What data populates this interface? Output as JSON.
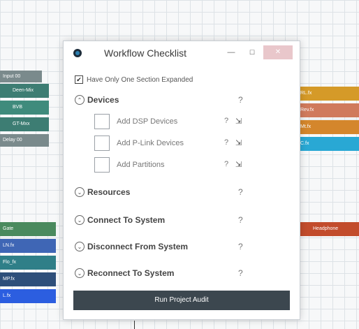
{
  "window": {
    "title": "Workflow Checklist",
    "min_symbol": "—",
    "max_symbol": "☐",
    "close_symbol": "✕"
  },
  "options": {
    "expand_check": "✔",
    "expand_label": "Have Only One Section Expanded"
  },
  "sections": [
    {
      "label": "Devices",
      "chevron": "⌃",
      "help": "?"
    },
    {
      "label": "Resources",
      "chevron": "⌄",
      "help": "?"
    },
    {
      "label": "Connect To System",
      "chevron": "⌄",
      "help": "?"
    },
    {
      "label": "Disconnect From System",
      "chevron": "⌄",
      "help": "?"
    },
    {
      "label": "Reconnect To System",
      "chevron": "⌄",
      "help": "?"
    }
  ],
  "device_items": [
    {
      "label": "Add DSP Devices",
      "help": "?",
      "pin": "⇲"
    },
    {
      "label": "Add P-Link Devices",
      "help": "?",
      "pin": "⇲"
    },
    {
      "label": "Add Partitions",
      "help": "?",
      "pin": "⇲"
    }
  ],
  "audit_button": "Run Project Audit",
  "background_blocks": {
    "left_top": [
      "Input 00",
      "Deen-Mix",
      "BVB",
      "GT-Mxx",
      "Delay 00"
    ],
    "left_bottom": [
      "Gate",
      "LN.fx",
      "Flo_fx",
      "MP.fx",
      "L.fx"
    ],
    "right_top": [
      "RL.fx",
      "Rev.fx",
      "Mt.fx",
      "C.fx"
    ],
    "right_bottom": [
      "Headphone"
    ]
  },
  "colors": {
    "teal_dark": "#3d7d73",
    "teal": "#3f8b7c",
    "gray_block": "#7a8a8c",
    "orange": "#d59a28",
    "salmon": "#d07a5c",
    "orange2": "#d4862c",
    "cyan": "#29a8d4",
    "green": "#4a8a5e",
    "blue": "#3f66b5",
    "teal2": "#2f7f88",
    "navy": "#2e4f7a",
    "blue_bright": "#2c5ee0",
    "red": "#c24c2c"
  }
}
